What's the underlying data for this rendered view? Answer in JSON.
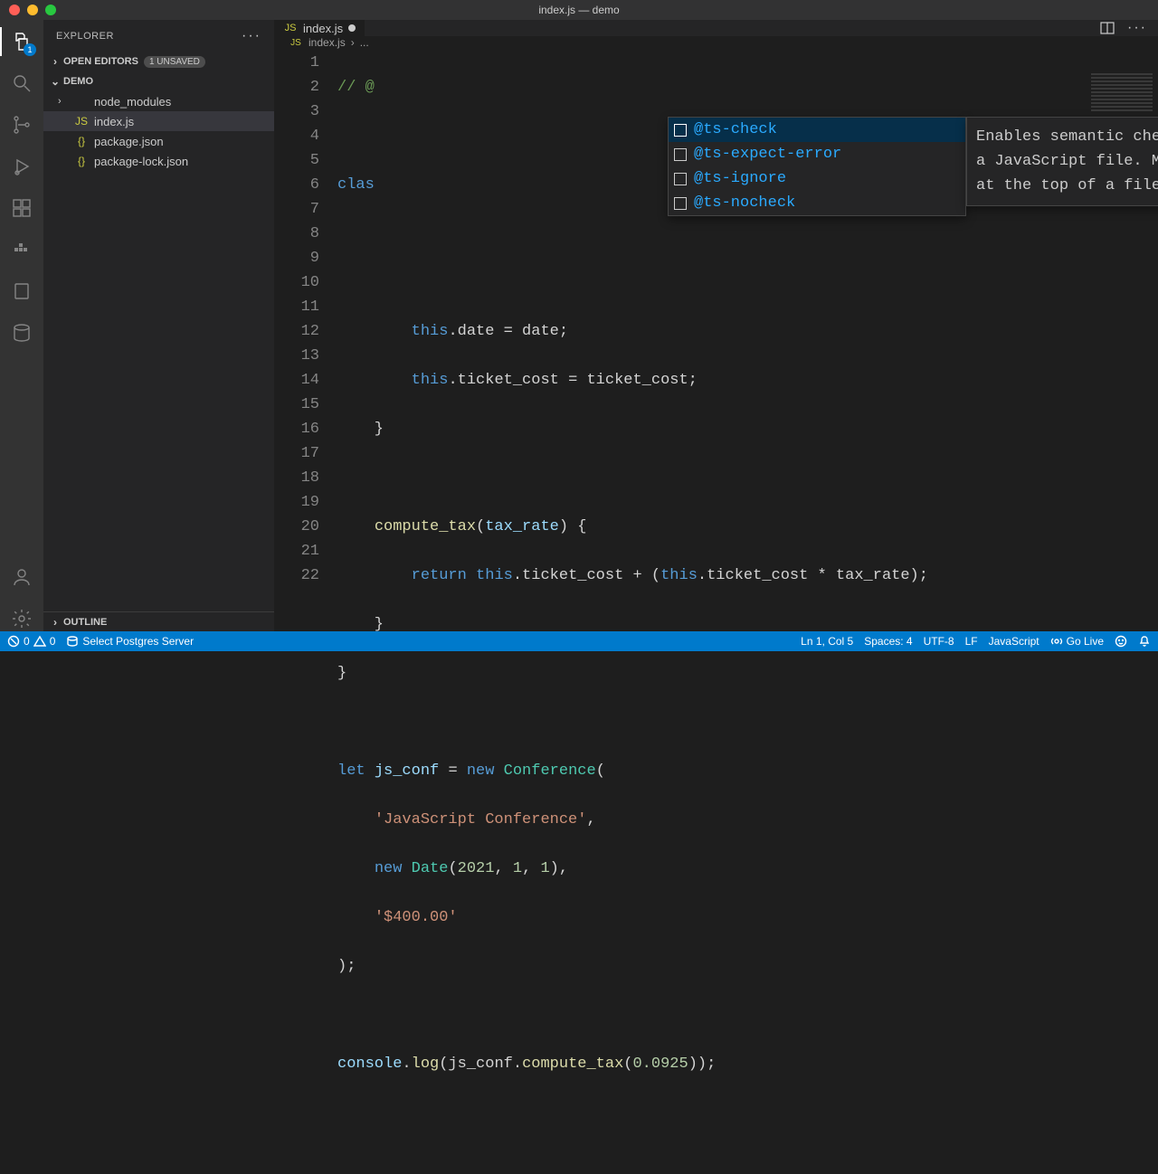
{
  "window": {
    "title": "index.js — demo"
  },
  "sidebar": {
    "title": "EXPLORER",
    "open_editors_label": "OPEN EDITORS",
    "unsaved_label": "1 UNSAVED",
    "project_label": "DEMO",
    "outline_label": "OUTLINE",
    "items": [
      {
        "label": "node_modules",
        "type": "folder"
      },
      {
        "label": "index.js",
        "type": "js"
      },
      {
        "label": "package.json",
        "type": "json"
      },
      {
        "label": "package-lock.json",
        "type": "json"
      }
    ]
  },
  "activity": {
    "explorer_badge": "1"
  },
  "tabs": {
    "active": {
      "label": "index.js",
      "icon_label": "JS"
    }
  },
  "breadcrumbs": {
    "file": "index.js",
    "sep": "›",
    "rest": "..."
  },
  "suggest": {
    "items": [
      {
        "label": "@ts-check"
      },
      {
        "label": "@ts-expect-error"
      },
      {
        "label": "@ts-ignore"
      },
      {
        "label": "@ts-nocheck"
      }
    ],
    "doc": "Enables semantic checking in a JavaScript file. Must be at the top of a file."
  },
  "code": {
    "lines": 22,
    "l1_a": "// ",
    "l1_b": "@",
    "l3_a": "clas",
    "l6_a": "this",
    "l6_b": ".date ",
    "l6_c": "=",
    "l6_d": " date;",
    "l7_a": "this",
    "l7_b": ".ticket_cost ",
    "l7_c": "=",
    "l7_d": " ticket_cost;",
    "l8": "    }",
    "l10_a": "    ",
    "l10_b": "compute_tax",
    "l10_c": "(",
    "l10_d": "tax_rate",
    "l10_e": ") {",
    "l11_a": "        ",
    "l11_b": "return",
    "l11_c": " ",
    "l11_d": "this",
    "l11_e": ".ticket_cost ",
    "l11_f": "+",
    "l11_g": " (",
    "l11_h": "this",
    "l11_i": ".ticket_cost ",
    "l11_j": "*",
    "l11_k": " tax_rate);",
    "l12": "    }",
    "l13": "}",
    "l15_a": "let",
    "l15_b": " ",
    "l15_c": "js_conf",
    "l15_d": " ",
    "l15_e": "=",
    "l15_f": " ",
    "l15_g": "new",
    "l15_h": " ",
    "l15_i": "Conference",
    "l15_j": "(",
    "l16_a": "    ",
    "l16_b": "'JavaScript Conference'",
    "l16_c": ",",
    "l17_a": "    ",
    "l17_b": "new",
    "l17_c": " ",
    "l17_d": "Date",
    "l17_e": "(",
    "l17_f": "2021",
    "l17_g": ", ",
    "l17_h": "1",
    "l17_i": ", ",
    "l17_j": "1",
    "l17_k": "),",
    "l18_a": "    ",
    "l18_b": "'$400.00'",
    "l19": ");",
    "l21_a": "console",
    "l21_b": ".",
    "l21_c": "log",
    "l21_d": "(js_conf.",
    "l21_e": "compute_tax",
    "l21_f": "(",
    "l21_g": "0.0925",
    "l21_h": "));"
  },
  "status": {
    "errors": "0",
    "warnings": "0",
    "postgres": "Select Postgres Server",
    "cursor": "Ln 1, Col 5",
    "spaces": "Spaces: 4",
    "encoding": "UTF-8",
    "eol": "LF",
    "lang": "JavaScript",
    "golive": "Go Live"
  }
}
